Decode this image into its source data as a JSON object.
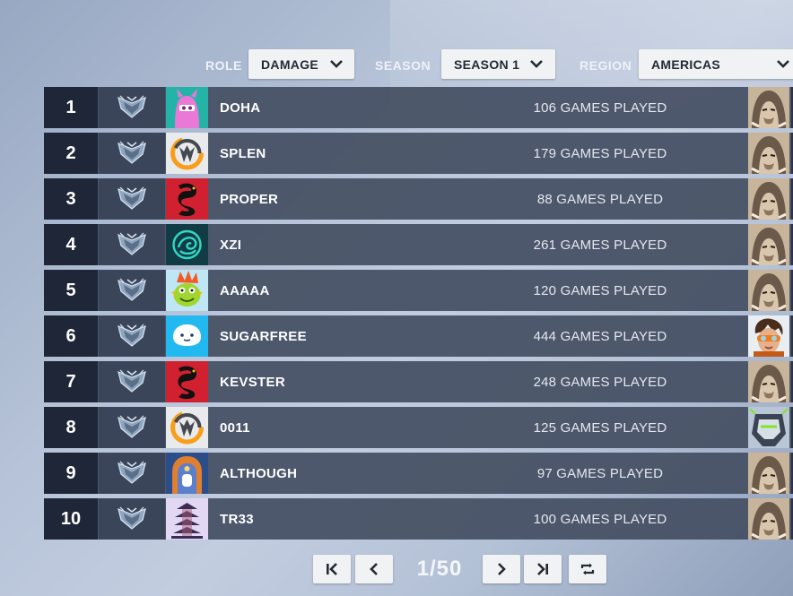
{
  "filters": {
    "role": {
      "label": "ROLE",
      "value": "DAMAGE"
    },
    "season": {
      "label": "SEASON",
      "value": "SEASON 1"
    },
    "region": {
      "label": "REGION",
      "value": "AMERICAS"
    }
  },
  "rows": [
    {
      "rank": "1",
      "name": "DOHA",
      "games": "106 GAMES PLAYED",
      "avatar_icon": "pink-creature-icon",
      "hero_icon": "hooded-hero-icon"
    },
    {
      "rank": "2",
      "name": "SPLEN",
      "games": "179 GAMES PLAYED",
      "avatar_icon": "overwatch-logo-icon",
      "hero_icon": "hooded-hero-icon"
    },
    {
      "rank": "3",
      "name": "PROPER",
      "games": "88 GAMES PLAYED",
      "avatar_icon": "red-dragon-icon",
      "hero_icon": "hooded-hero-icon"
    },
    {
      "rank": "4",
      "name": "XZI",
      "games": "261 GAMES PLAYED",
      "avatar_icon": "teal-dragon-icon",
      "hero_icon": "hooded-hero-icon"
    },
    {
      "rank": "5",
      "name": "AAAAA",
      "games": "120 GAMES PLAYED",
      "avatar_icon": "green-creature-icon",
      "hero_icon": "hooded-hero-icon"
    },
    {
      "rank": "6",
      "name": "SUGARFREE",
      "games": "444 GAMES PLAYED",
      "avatar_icon": "cloud-creature-icon",
      "hero_icon": "goggles-hero-icon"
    },
    {
      "rank": "7",
      "name": "KEVSTER",
      "games": "248 GAMES PLAYED",
      "avatar_icon": "red-dragon-icon",
      "hero_icon": "hooded-hero-icon"
    },
    {
      "rank": "8",
      "name": "0011",
      "games": "125 GAMES PLAYED",
      "avatar_icon": "overwatch-logo-icon",
      "hero_icon": "armored-hero-icon"
    },
    {
      "rank": "9",
      "name": "ALTHOUGH",
      "games": "97 GAMES PLAYED",
      "avatar_icon": "shrine-icon",
      "hero_icon": "hooded-hero-icon"
    },
    {
      "rank": "10",
      "name": "TR33",
      "games": "100 GAMES PLAYED",
      "avatar_icon": "pagoda-icon",
      "hero_icon": "hooded-hero-icon"
    }
  ],
  "pagination": {
    "page_label": "1/50",
    "first_icon": "first-page-icon",
    "prev_icon": "previous-page-icon",
    "next_icon": "next-page-icon",
    "last_icon": "last-page-icon",
    "refresh_icon": "refresh-icon"
  },
  "colors": {
    "rank_bg": "#1f2637",
    "row_bg": "#444e62",
    "dropdown_bg": "#f1f2f4",
    "tier_badge": "#9fb3cc"
  }
}
